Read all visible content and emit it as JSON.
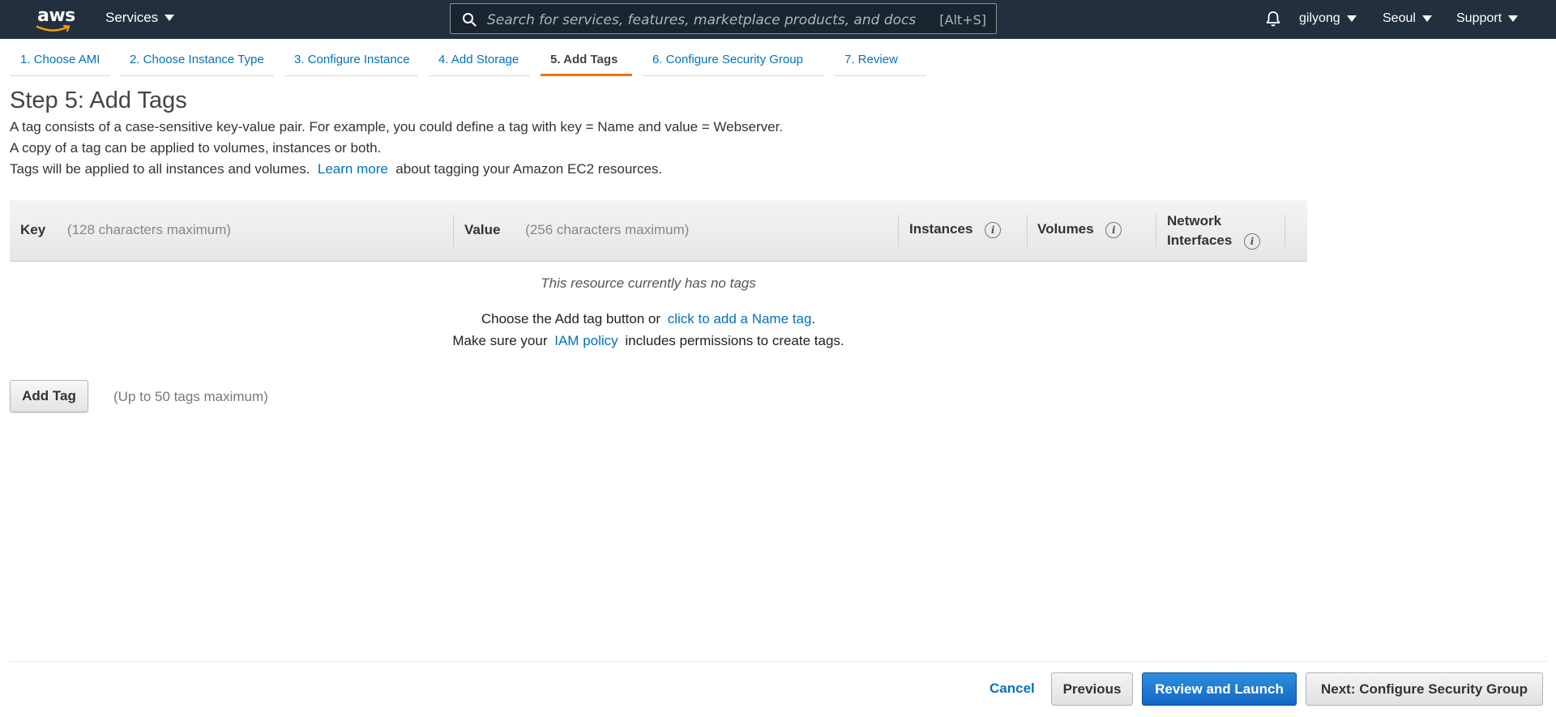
{
  "nav": {
    "logo_text": "aws",
    "services_label": "Services",
    "search_placeholder": "Search for services, features, marketplace products, and docs",
    "search_shortcut": "[Alt+S]",
    "user": "gilyong",
    "region": "Seoul",
    "support": "Support"
  },
  "tabs": [
    {
      "label": "1. Choose AMI"
    },
    {
      "label": "2. Choose Instance Type"
    },
    {
      "label": "3. Configure Instance"
    },
    {
      "label": "4. Add Storage"
    },
    {
      "label": "5. Add Tags",
      "active": true
    },
    {
      "label": "6. Configure Security Group"
    },
    {
      "label": "7. Review"
    }
  ],
  "page": {
    "title": "Step 5: Add Tags",
    "desc1": "A tag consists of a case-sensitive key-value pair. For example, you could define a tag with key = Name and value = Webserver.",
    "desc2": "A copy of a tag can be applied to volumes, instances or both.",
    "desc3_pre": "Tags will be applied to all instances and volumes.",
    "desc3_link": "Learn more",
    "desc3_post": "about tagging your Amazon EC2 resources."
  },
  "table": {
    "key_label": "Key",
    "key_hint": "(128 characters maximum)",
    "value_label": "Value",
    "value_hint": "(256 characters maximum)",
    "instances_label": "Instances",
    "volumes_label": "Volumes",
    "network_label_1": "Network",
    "network_label_2": "Interfaces",
    "info_glyph": "i",
    "empty_message": "This resource currently has no tags",
    "line1_pre": "Choose the Add tag button or",
    "line1_link": "click to add a Name tag",
    "line1_post": ".",
    "line2_pre": "Make sure your",
    "line2_link": "IAM policy",
    "line2_post": "includes permissions to create tags."
  },
  "add_tag": {
    "button_label": "Add Tag",
    "hint": "(Up to 50 tags maximum)"
  },
  "footer": {
    "cancel": "Cancel",
    "previous": "Previous",
    "review_launch": "Review and Launch",
    "next": "Next: Configure Security Group"
  },
  "colors": {
    "nav_bg": "#232f3e",
    "link": "#0073bb",
    "active_tab_underline": "#ec7211",
    "primary_button": "#1266c4"
  }
}
